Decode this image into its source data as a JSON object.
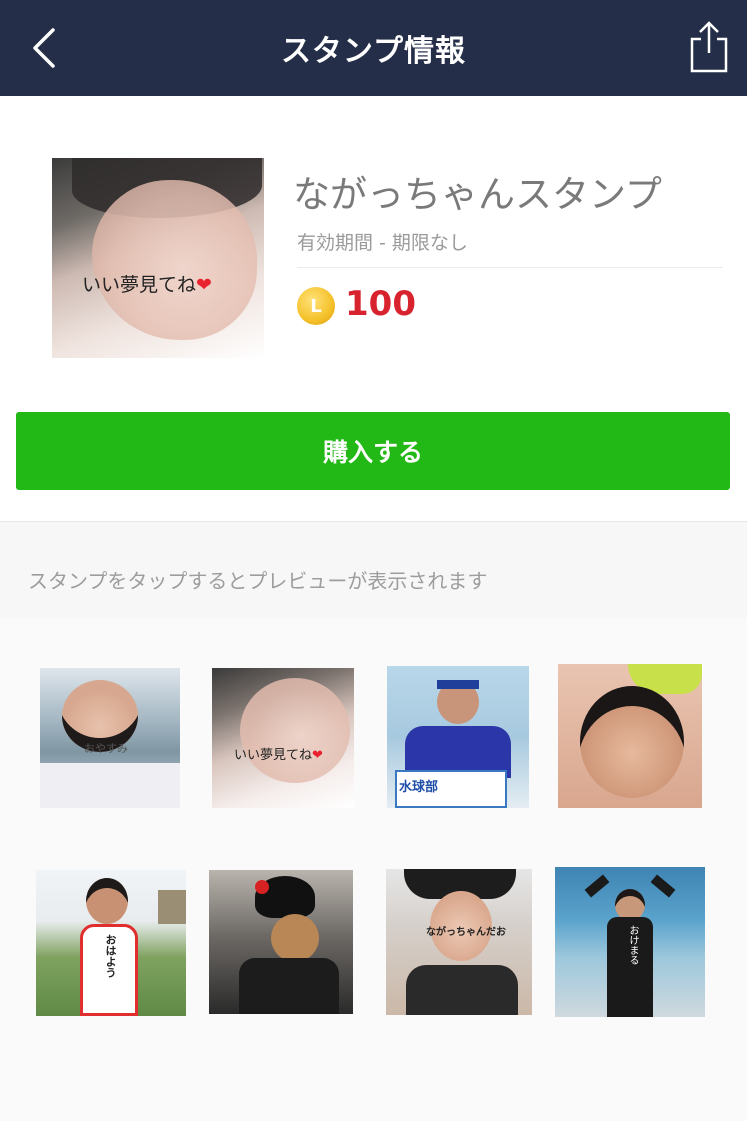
{
  "header": {
    "title": "スタンプ情報"
  },
  "sticker_pack": {
    "title": "ながっちゃんスタンプ",
    "validity": "有効期間 - 期限なし",
    "coin_symbol": "L",
    "price": "100",
    "thumb_caption": "いい夢見てね",
    "heart": "❤"
  },
  "buy_button": {
    "label": "購入する"
  },
  "hint": {
    "text": "スタンプをタップするとプレビューが表示されます"
  },
  "stickers": {
    "s1": {
      "caption": "おやすみ"
    },
    "s2": {
      "caption": "いい夢見てね"
    },
    "s3": {
      "caption": "水球部"
    },
    "s5": {
      "caption": "おはよう"
    },
    "s7": {
      "caption": "ながっちゃんだお"
    },
    "s8": {
      "caption": "おけまる"
    }
  },
  "colors": {
    "header_bg": "#252e48",
    "buy_green": "#22b815",
    "price_red": "#d8232f",
    "coin_gold": "#f4c12a"
  }
}
